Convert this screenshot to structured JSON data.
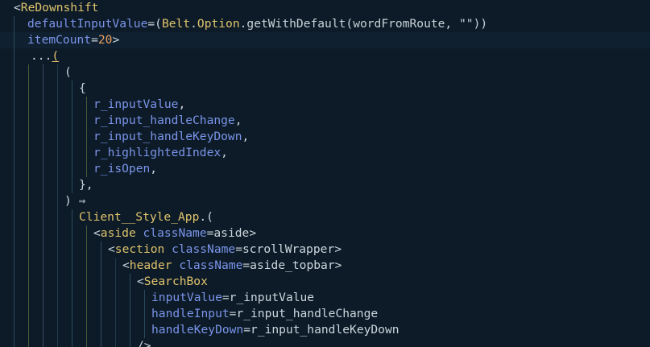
{
  "editor": {
    "colors": {
      "background": "#0c1b27",
      "current_line": "#0f2130",
      "tag": "#e0c36d",
      "identifier": "#7c94ea",
      "number": "#e8a064",
      "text": "#cdd6de"
    },
    "current_line_index": 2,
    "lines": [
      {
        "tokens": [
          {
            "t": "<",
            "c": "punct"
          },
          {
            "t": "ReDownshift",
            "c": "tag"
          }
        ]
      },
      {
        "tokens": [
          {
            "t": "defaultInputValue",
            "c": "attr"
          },
          {
            "t": "=(",
            "c": "op"
          },
          {
            "t": "Belt",
            "c": "mod"
          },
          {
            "t": ".",
            "c": "punct"
          },
          {
            "t": "Option",
            "c": "mod"
          },
          {
            "t": ".getWithDefault(wordFromRoute, \"\"))",
            "c": "fn"
          }
        ]
      },
      {
        "tokens": [
          {
            "t": "itemCount",
            "c": "attr"
          },
          {
            "t": "=",
            "c": "op"
          },
          {
            "t": "20",
            "c": "num"
          },
          {
            "t": ">",
            "c": "punct"
          }
        ]
      },
      {
        "tokens": [
          {
            "t": "...",
            "c": "op"
          },
          {
            "t": "(",
            "c": "bracket"
          }
        ]
      },
      {
        "tokens": [
          {
            "t": "(",
            "c": "punct"
          }
        ]
      },
      {
        "tokens": [
          {
            "t": "{",
            "c": "punct"
          }
        ]
      },
      {
        "tokens": [
          {
            "t": "r_inputValue",
            "c": "ident"
          },
          {
            "t": ",",
            "c": "punct"
          }
        ]
      },
      {
        "tokens": [
          {
            "t": "r_input_handleChange",
            "c": "ident"
          },
          {
            "t": ",",
            "c": "punct"
          }
        ]
      },
      {
        "tokens": [
          {
            "t": "r_input_handleKeyDown",
            "c": "ident"
          },
          {
            "t": ",",
            "c": "punct"
          }
        ]
      },
      {
        "tokens": [
          {
            "t": "r_highlightedIndex",
            "c": "ident"
          },
          {
            "t": ",",
            "c": "punct"
          }
        ]
      },
      {
        "tokens": [
          {
            "t": "r_isOpen",
            "c": "ident"
          },
          {
            "t": ",",
            "c": "punct"
          }
        ]
      },
      {
        "tokens": [
          {
            "t": "},",
            "c": "punct"
          }
        ]
      },
      {
        "tokens": [
          {
            "t": ") ⇒",
            "c": "punct"
          }
        ]
      },
      {
        "tokens": [
          {
            "t": "Client__Style_App",
            "c": "mod"
          },
          {
            "t": ".(",
            "c": "punct"
          }
        ]
      },
      {
        "tokens": [
          {
            "t": "<",
            "c": "punct"
          },
          {
            "t": "aside",
            "c": "tag"
          },
          {
            "t": " ",
            "c": "punct"
          },
          {
            "t": "className",
            "c": "attr"
          },
          {
            "t": "=aside>",
            "c": "op"
          }
        ]
      },
      {
        "tokens": [
          {
            "t": "<",
            "c": "punct"
          },
          {
            "t": "section",
            "c": "tag"
          },
          {
            "t": " ",
            "c": "punct"
          },
          {
            "t": "className",
            "c": "attr"
          },
          {
            "t": "=scrollWrapper>",
            "c": "op"
          }
        ]
      },
      {
        "tokens": [
          {
            "t": "<",
            "c": "punct"
          },
          {
            "t": "header",
            "c": "tag"
          },
          {
            "t": " ",
            "c": "punct"
          },
          {
            "t": "className",
            "c": "attr"
          },
          {
            "t": "=aside_topbar>",
            "c": "op"
          }
        ]
      },
      {
        "tokens": [
          {
            "t": "<",
            "c": "punct"
          },
          {
            "t": "SearchBox",
            "c": "tag"
          }
        ]
      },
      {
        "tokens": [
          {
            "t": "inputValue",
            "c": "attr"
          },
          {
            "t": "=r_inputValue",
            "c": "op"
          }
        ]
      },
      {
        "tokens": [
          {
            "t": "handleInput",
            "c": "attr"
          },
          {
            "t": "=r_input_handleChange",
            "c": "op"
          }
        ]
      },
      {
        "tokens": [
          {
            "t": "handleKeyDown",
            "c": "attr"
          },
          {
            "t": "=r_input_handleKeyDown",
            "c": "op"
          }
        ]
      },
      {
        "tokens": [
          {
            "t": "/>",
            "c": "punct"
          }
        ]
      }
    ]
  }
}
